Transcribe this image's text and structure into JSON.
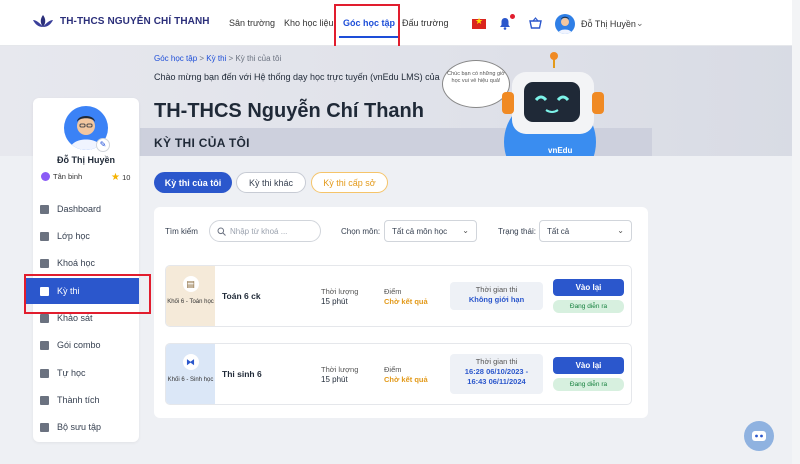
{
  "header": {
    "logo_text": "TH-THCS NGUYỄN CHÍ THANH",
    "nav": [
      "Sân trường",
      "Kho học liệu",
      "Góc học tập",
      "Đấu trường"
    ],
    "user_name": "Đỗ Thị Huyền"
  },
  "banner": {
    "breadcrumb": [
      "Góc học tập",
      "Kỳ thi",
      "Kỳ thi của tôi"
    ],
    "breadcrumb_sep": ">",
    "welcome": "Chào mừng bạn đến với Hệ thống dạy học trực tuyến (vnEdu LMS) của",
    "school": "TH-THCS Nguyễn Chí Thanh",
    "section_title": "KỲ THI CỦA TÔI",
    "bubble": "Chúc bạn có những giờ học vui vẻ hiệu quả!",
    "robot_label": "vnEdu"
  },
  "sidebar": {
    "name": "Đỗ Thị Huyền",
    "rank": "Tân binh",
    "stars": "10",
    "items": [
      "Dashboard",
      "Lớp học",
      "Khoá học",
      "Kỳ thi",
      "Khảo sát",
      "Gói combo",
      "Tự học",
      "Thành tích",
      "Bộ sưu tập"
    ]
  },
  "tabs": [
    "Kỳ thi của tôi",
    "Kỳ thi khác",
    "Kỳ thi cấp sở"
  ],
  "filters": {
    "search_label": "Tìm kiếm",
    "search_placeholder": "Nhập từ khoá ...",
    "subject_label": "Chọn môn:",
    "subject_value": "Tất cả môn học",
    "status_label": "Trạng thái:",
    "status_value": "Tất cả"
  },
  "exams": [
    {
      "thumb": "Khối 6 - Toán học",
      "name": "Toán 6 ck",
      "duration_label": "Thời lượng",
      "duration": "15 phút",
      "score_label": "Điểm",
      "score": "Chờ kết quả",
      "time_label": "Thời gian thi",
      "time_line1": "Không giới hạn",
      "time_line2": "",
      "button": "Vào lại",
      "status": "Đang diễn ra"
    },
    {
      "thumb": "Khối 6 - Sinh học",
      "name": "Thi sinh 6",
      "duration_label": "Thời lượng",
      "duration": "15 phút",
      "score_label": "Điểm",
      "score": "Chờ kết quả",
      "time_label": "Thời gian thi",
      "time_line1": "16:28 06/10/2023 -",
      "time_line2": "16:43 06/11/2024",
      "button": "Vào lại",
      "status": "Đang diễn ra"
    }
  ],
  "colors": {
    "primary": "#2b57cc",
    "accent": "#e39a1a",
    "highlight": "#e11d2e"
  }
}
